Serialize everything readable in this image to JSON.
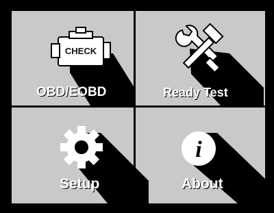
{
  "menu": {
    "items": [
      {
        "label": "OBD/EOBD",
        "icon": "check-engine-icon",
        "icon_text": "CHECK"
      },
      {
        "label": "Ready Test",
        "icon": "tools-icon"
      },
      {
        "label": "Setup",
        "icon": "gear-icon"
      },
      {
        "label": "About",
        "icon": "info-icon",
        "icon_text": "i"
      }
    ]
  },
  "colors": {
    "background": "#000000",
    "panel": "#c9c9c9",
    "icon_white": "#ffffff",
    "shadow": "#000000"
  }
}
